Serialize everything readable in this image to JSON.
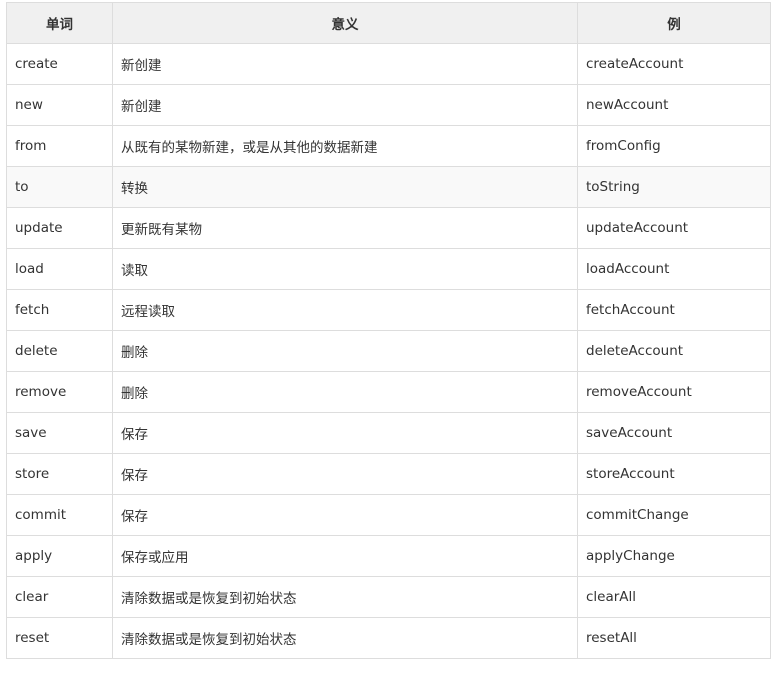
{
  "table": {
    "headers": [
      "单词",
      "意义",
      "例"
    ],
    "rows": [
      {
        "word": "create",
        "meaning": "新创建",
        "example": "createAccount"
      },
      {
        "word": "new",
        "meaning": "新创建",
        "example": "newAccount"
      },
      {
        "word": "from",
        "meaning": "从既有的某物新建，或是从其他的数据新建",
        "example": "fromConfig"
      },
      {
        "word": "to",
        "meaning": "转换",
        "example": "toString"
      },
      {
        "word": "update",
        "meaning": "更新既有某物",
        "example": "updateAccount"
      },
      {
        "word": "load",
        "meaning": "读取",
        "example": "loadAccount"
      },
      {
        "word": "fetch",
        "meaning": "远程读取",
        "example": "fetchAccount"
      },
      {
        "word": "delete",
        "meaning": "删除",
        "example": "deleteAccount"
      },
      {
        "word": "remove",
        "meaning": "删除",
        "example": "removeAccount"
      },
      {
        "word": "save",
        "meaning": "保存",
        "example": "saveAccount"
      },
      {
        "word": "store",
        "meaning": "保存",
        "example": "storeAccount"
      },
      {
        "word": "commit",
        "meaning": "保存",
        "example": "commitChange"
      },
      {
        "word": "apply",
        "meaning": "保存或应用",
        "example": "applyChange"
      },
      {
        "word": "clear",
        "meaning": "清除数据或是恢复到初始状态",
        "example": "clearAll"
      },
      {
        "word": "reset",
        "meaning": "清除数据或是恢复到初始状态",
        "example": "resetAll"
      }
    ],
    "highlighted_row": 3
  },
  "colors": {
    "header_bg": "#f0f0f0",
    "border": "#dddddd",
    "highlight_row_bg": "#f9f9f9",
    "text": "#333333"
  }
}
